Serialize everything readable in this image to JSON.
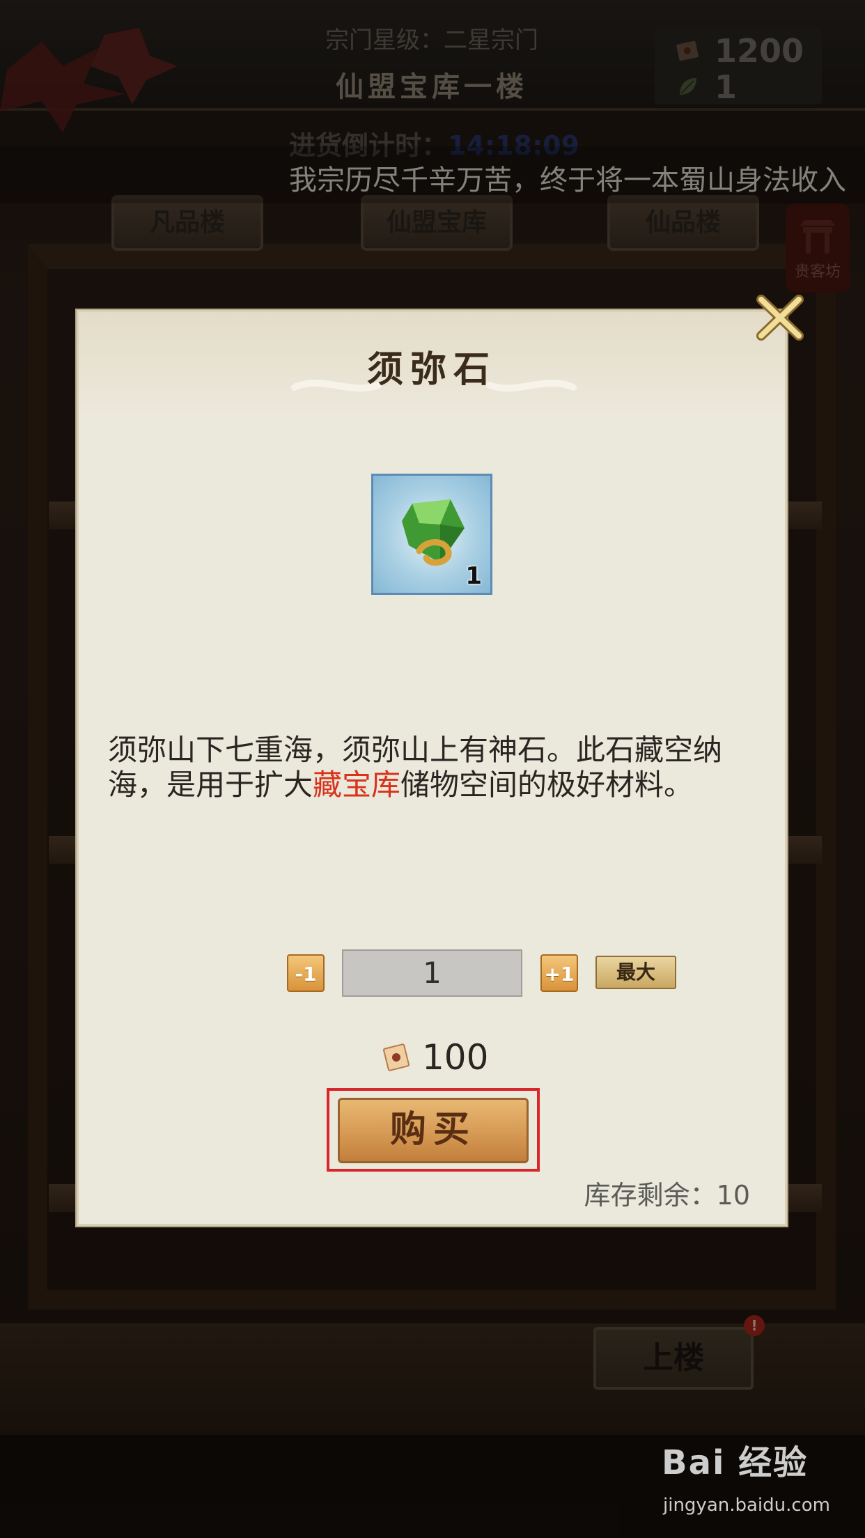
{
  "header": {
    "sect_level": "宗门星级：二星宗门",
    "hall_name": "仙盟宝库一楼",
    "currency": [
      {
        "icon": "ticket-icon",
        "value": "1200"
      },
      {
        "icon": "leaf-icon",
        "value": "1"
      }
    ],
    "countdown_label": "进货倒计时：",
    "countdown_time": "14:18:09",
    "ticker": "我宗历尽千辛万苦，终于将一本蜀山身法收入"
  },
  "tabs": [
    "凡品楼",
    "仙盟宝库",
    "仙品楼"
  ],
  "guest_button": "贵客坊",
  "upstairs_button": "上楼",
  "dialog": {
    "title": "须弥石",
    "item": {
      "icon": "jade-gem-icon",
      "count": "1"
    },
    "description_before": "须弥山下七重海，须弥山上有神石。此石藏空纳海，是用于扩大",
    "description_highlight": "藏宝库",
    "description_after": "储物空间的极好材料。",
    "minus_label": "-1",
    "quantity": "1",
    "plus_label": "+1",
    "max_label": "最大",
    "price": "100",
    "buy_label": "购买",
    "stock_text": "库存剩余：10"
  },
  "watermark": {
    "main": "Bai 经验",
    "url": "jingyan.baidu.com"
  },
  "colors": {
    "highlight": "#d8331c",
    "buy_outline": "#d8262b",
    "dialog_bg": "#ebe8dc"
  }
}
